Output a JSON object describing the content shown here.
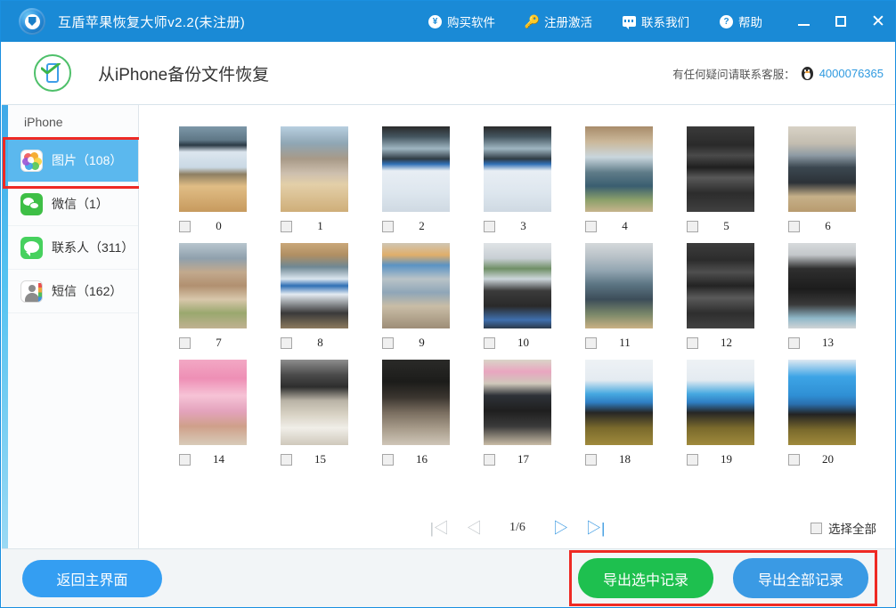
{
  "titlebar": {
    "app_name": "互盾苹果恢复大师v2.2(未注册)",
    "logo_icon": "app-logo-icon",
    "menu": [
      {
        "label": "购买软件",
        "icon": "yuan-circle-icon"
      },
      {
        "label": "注册激活",
        "icon": "key-icon"
      },
      {
        "label": "联系我们",
        "icon": "chat-bubble-icon"
      },
      {
        "label": "帮助",
        "icon": "question-circle-icon"
      }
    ],
    "window_buttons": [
      {
        "name": "minimize",
        "glyph": "—"
      },
      {
        "name": "maximize",
        "glyph": "▢"
      },
      {
        "name": "close",
        "glyph": "✕"
      }
    ]
  },
  "header": {
    "icon": "iphone-check-icon",
    "title": "从iPhone备份文件恢复",
    "support_text": "有任何疑问请联系客服：",
    "qq_icon": "qq-penguin-icon",
    "support_phone": "4000076365"
  },
  "sidebar": {
    "device_label": "iPhone",
    "items": [
      {
        "label": "图片（108）",
        "icon": "photos-icon",
        "active": true,
        "highlighted": true
      },
      {
        "label": "微信（1）",
        "icon": "wechat-icon",
        "active": false,
        "highlighted": false
      },
      {
        "label": "联系人（311）",
        "icon": "messages-icon",
        "active": false,
        "highlighted": false
      },
      {
        "label": "短信（162）",
        "icon": "contacts-icon",
        "active": false,
        "highlighted": false
      }
    ]
  },
  "gallery": {
    "columns": 7,
    "items": [
      {
        "num": "0",
        "checked": false,
        "alt": "desk with monitor and keyboard"
      },
      {
        "num": "1",
        "checked": false,
        "alt": "office desk with mouse pad"
      },
      {
        "num": "2",
        "checked": false,
        "alt": "monitor showing blue webpage"
      },
      {
        "num": "3",
        "checked": false,
        "alt": "monitor showing blue webpage"
      },
      {
        "num": "4",
        "checked": false,
        "alt": "office interior with plants"
      },
      {
        "num": "5",
        "checked": false,
        "alt": "close-up of keyboard keys"
      },
      {
        "num": "6",
        "checked": false,
        "alt": "person working at desk"
      },
      {
        "num": "7",
        "checked": false,
        "alt": "office desk area"
      },
      {
        "num": "8",
        "checked": false,
        "alt": "monitor on desk near window"
      },
      {
        "num": "9",
        "checked": false,
        "alt": "water bottles and shelf"
      },
      {
        "num": "10",
        "checked": false,
        "alt": "person seated in office"
      },
      {
        "num": "11",
        "checked": false,
        "alt": "open plan office"
      },
      {
        "num": "12",
        "checked": false,
        "alt": "close-up of keyboard keys"
      },
      {
        "num": "13",
        "checked": false,
        "alt": "black computer mouse"
      },
      {
        "num": "14",
        "checked": false,
        "alt": "pink helmet with cartoon"
      },
      {
        "num": "15",
        "checked": false,
        "alt": "thermos bottle on floor"
      },
      {
        "num": "16",
        "checked": false,
        "alt": "dark blurry floor shot"
      },
      {
        "num": "17",
        "checked": false,
        "alt": "glass and keyboard on desk"
      },
      {
        "num": "18",
        "checked": false,
        "alt": "screen with blue interface"
      },
      {
        "num": "19",
        "checked": false,
        "alt": "screen with blue interface"
      },
      {
        "num": "20",
        "checked": false,
        "alt": "screen with blue interface"
      }
    ],
    "pagination": {
      "first_glyph": "|◁",
      "prev_glyph": "◁",
      "page_label": "1/6",
      "next_glyph": "▷",
      "last_glyph": "▷|",
      "first_disabled": true,
      "prev_disabled": true,
      "next_disabled": false,
      "last_disabled": false
    },
    "select_all_label": "选择全部",
    "select_all_checked": false
  },
  "footer": {
    "back_label": "返回主界面",
    "export_selected_label": "导出选中记录",
    "export_all_label": "导出全部记录"
  },
  "colors": {
    "titlebar_blue": "#1a8ad6",
    "accent_blue": "#349ef2",
    "export_green": "#1ec04f",
    "highlight_red": "#ee2a24",
    "sidebar_active": "#5bb8ee"
  }
}
